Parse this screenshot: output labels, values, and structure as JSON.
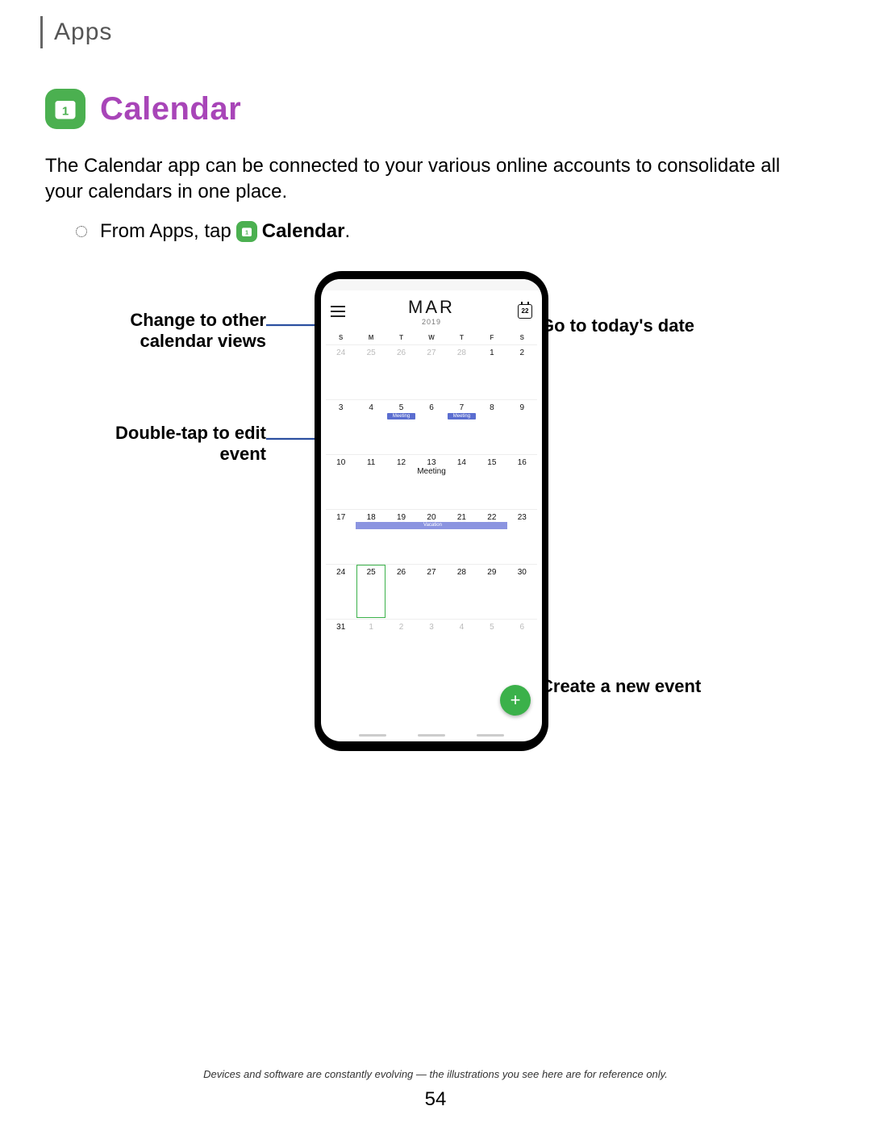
{
  "breadcrumb": "Apps",
  "title": "Calendar",
  "app_icon_date": "1",
  "intro": "The Calendar app can be connected to your various online accounts to consolidate all your calendars in one place.",
  "step": {
    "prefix": "From Apps, tap",
    "icon_date": "1",
    "strong": "Calendar",
    "suffix": "."
  },
  "callouts": {
    "views": "Change to other calendar views",
    "edit": "Double-tap to edit event",
    "today": "Go to today's date",
    "create": "Create a new event"
  },
  "phone": {
    "month": "MAR",
    "year": "2019",
    "today_badge": "22",
    "dow": [
      "S",
      "M",
      "T",
      "W",
      "T",
      "F",
      "S"
    ],
    "weeks": [
      [
        {
          "n": "24",
          "dim": true
        },
        {
          "n": "25",
          "dim": true
        },
        {
          "n": "26",
          "dim": true
        },
        {
          "n": "27",
          "dim": true
        },
        {
          "n": "28",
          "dim": true
        },
        {
          "n": "1"
        },
        {
          "n": "2"
        }
      ],
      [
        {
          "n": "3"
        },
        {
          "n": "4"
        },
        {
          "n": "5",
          "ev": "Meeting"
        },
        {
          "n": "6"
        },
        {
          "n": "7",
          "ev": "Meeting"
        },
        {
          "n": "8"
        },
        {
          "n": "9"
        }
      ],
      [
        {
          "n": "10"
        },
        {
          "n": "11"
        },
        {
          "n": "12"
        },
        {
          "n": "13",
          "evtxt": "Meeting"
        },
        {
          "n": "14"
        },
        {
          "n": "15"
        },
        {
          "n": "16"
        }
      ],
      [
        {
          "n": "17"
        },
        {
          "n": "18"
        },
        {
          "n": "19"
        },
        {
          "n": "20"
        },
        {
          "n": "21"
        },
        {
          "n": "22"
        },
        {
          "n": "23"
        }
      ],
      [
        {
          "n": "24"
        },
        {
          "n": "25",
          "today": true
        },
        {
          "n": "26"
        },
        {
          "n": "27"
        },
        {
          "n": "28"
        },
        {
          "n": "29"
        },
        {
          "n": "30"
        }
      ],
      [
        {
          "n": "31"
        },
        {
          "n": "1",
          "dim": true
        },
        {
          "n": "2",
          "dim": true
        },
        {
          "n": "3",
          "dim": true
        },
        {
          "n": "4",
          "dim": true
        },
        {
          "n": "5",
          "dim": true
        },
        {
          "n": "6",
          "dim": true
        }
      ]
    ],
    "vacation_label": "Vacation",
    "fab": "+"
  },
  "footer_note": "Devices and software are constantly evolving — the illustrations you see here are for reference only.",
  "page_number": "54"
}
